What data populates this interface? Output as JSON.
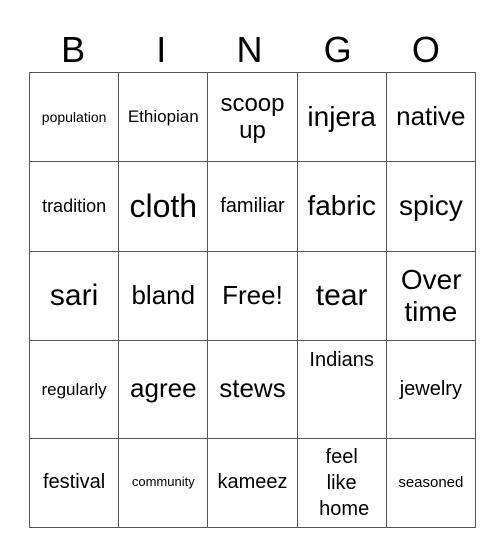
{
  "header": [
    "B",
    "I",
    "N",
    "G",
    "O"
  ],
  "rows": [
    [
      "population",
      "Ethiopian",
      "scoop up",
      "injera",
      "native"
    ],
    [
      "tradition",
      "cloth",
      "familiar",
      "fabric",
      "spicy"
    ],
    [
      "sari",
      "bland",
      "Free!",
      "tear",
      "Over time"
    ],
    [
      "regularly",
      "agree",
      "stews",
      "Indians",
      "jewelry"
    ],
    [
      "festival",
      "community",
      "kameez",
      "feel like home",
      "seasoned"
    ]
  ]
}
